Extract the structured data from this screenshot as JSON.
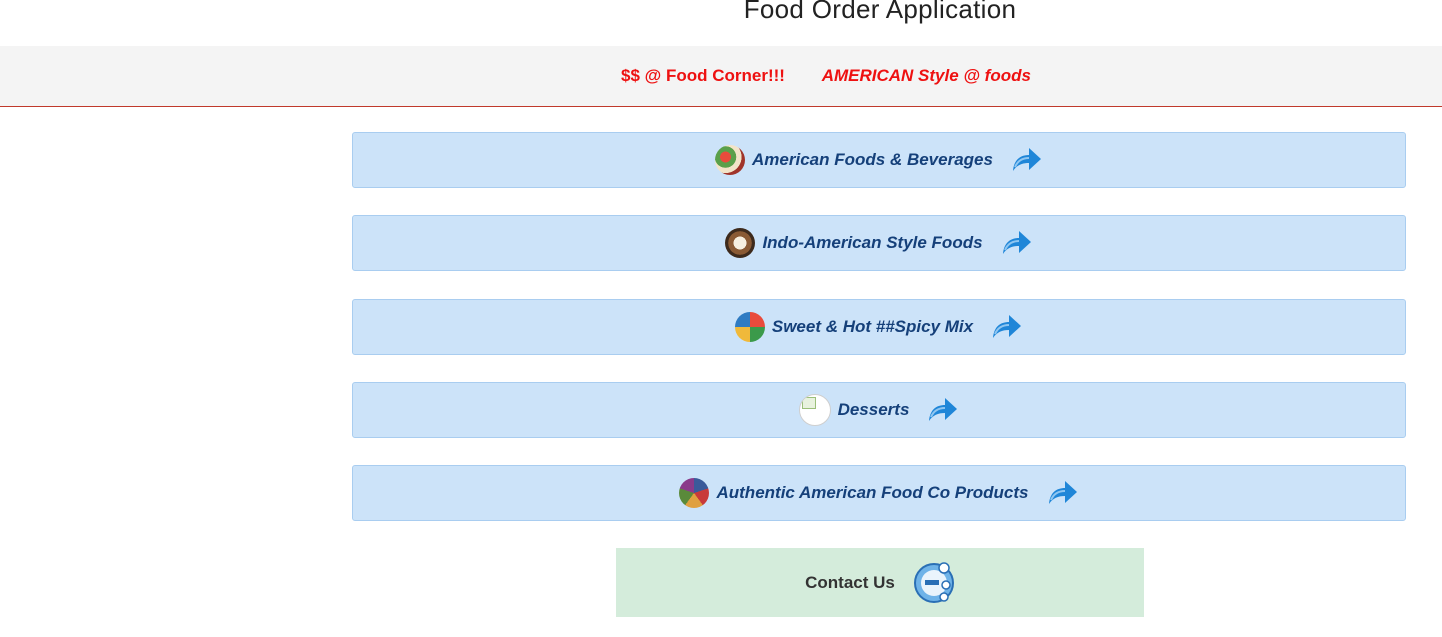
{
  "app": {
    "title": "Food Order Application"
  },
  "banner": {
    "tagline_1": "$$ @ Food Corner!!!",
    "tagline_2": "AMERICAN Style @ foods"
  },
  "menu": {
    "items": [
      {
        "label": "American Foods & Beverages",
        "icon": "food-photo-icon"
      },
      {
        "label": "Indo-American Style Foods",
        "icon": "food-photo-icon"
      },
      {
        "label": "Sweet & Hot ##Spicy Mix",
        "icon": "food-photo-icon"
      },
      {
        "label": "Desserts",
        "icon": "broken-image-icon"
      },
      {
        "label": "Authentic American Food Co Products",
        "icon": "food-photo-icon"
      }
    ],
    "arrow_icon": "forward-arrow-icon"
  },
  "contact": {
    "label": "Contact Us",
    "icon": "contact-globe-icon"
  },
  "colors": {
    "banner_text": "#ee1111",
    "menu_bg": "#cce3f9",
    "menu_text": "#15407a",
    "contact_bg": "#d4ecdb",
    "arrow": "#1f86d8"
  }
}
